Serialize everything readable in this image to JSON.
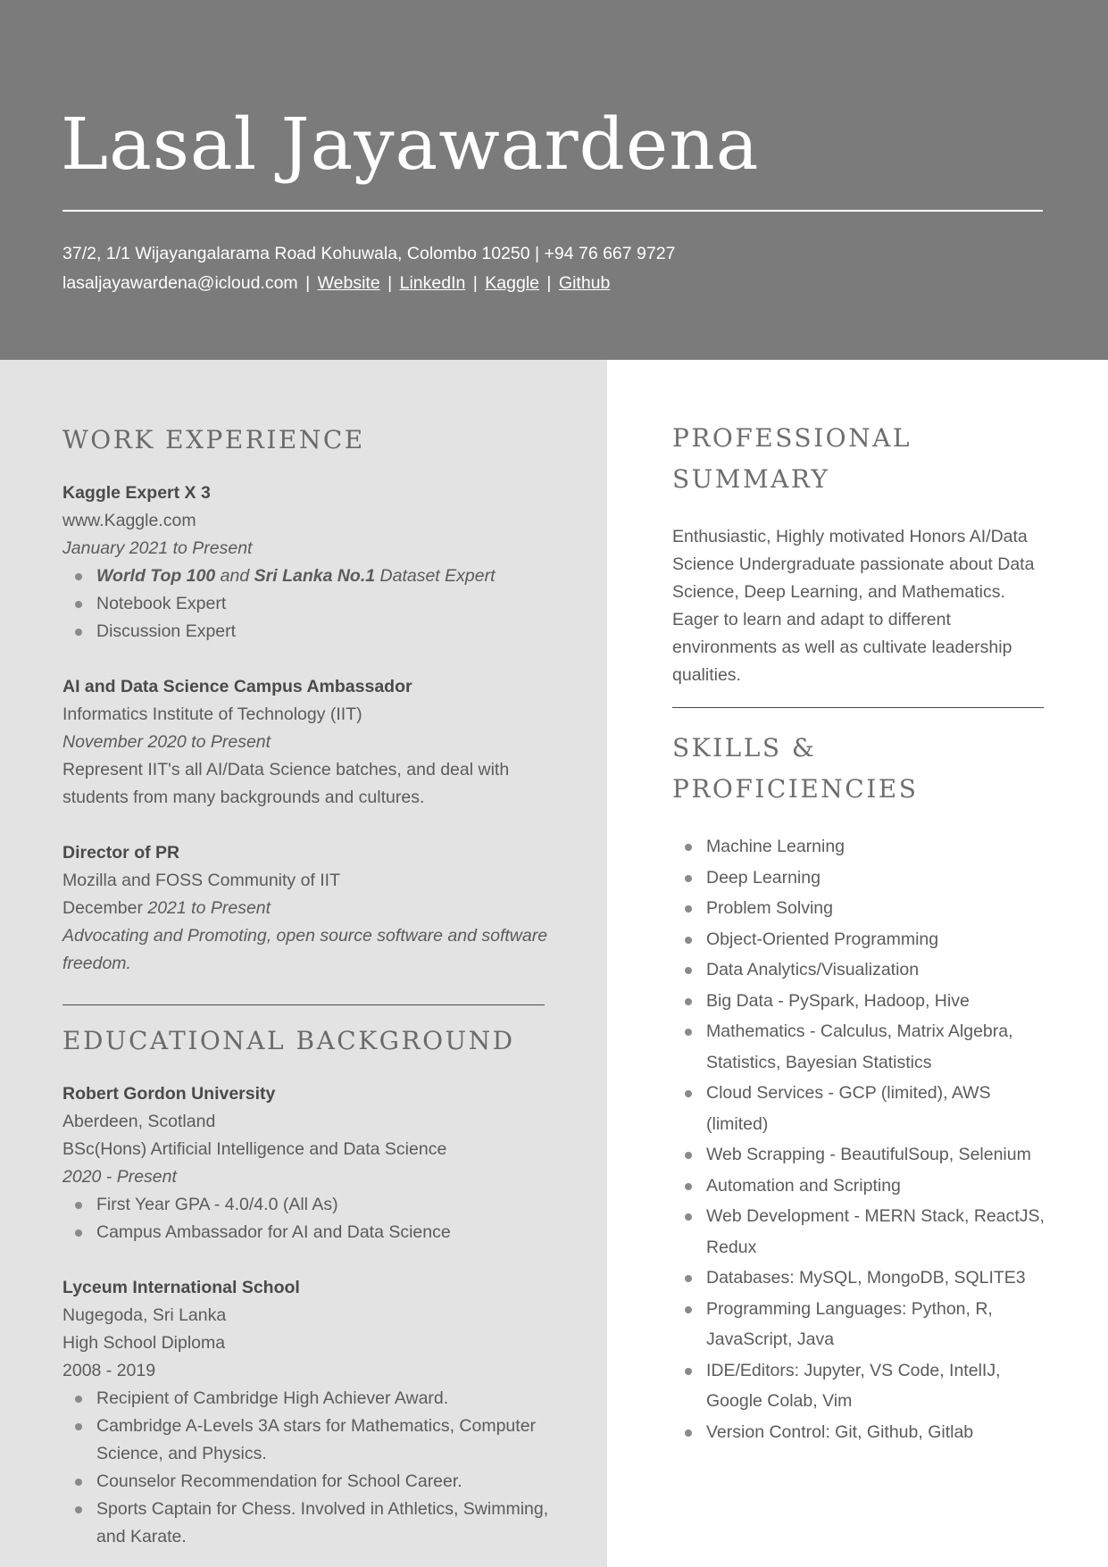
{
  "header": {
    "name": "Lasal Jayawardena",
    "address_phone": "37/2, 1/1 Wijayangalarama Road Kohuwala, Colombo 10250 | +94 76 667 9727",
    "email": "lasaljayawardena@icloud.com",
    "links": [
      "Website",
      "LinkedIn",
      "Kaggle",
      "Github"
    ],
    "separator": "|"
  },
  "work_experience": {
    "title": "WORK EXPERIENCE",
    "entries": [
      {
        "title": "Kaggle Expert X 3",
        "org": "www.Kaggle.com",
        "dates": "January 2021 to Present",
        "bullets": [
          {
            "parts": [
              {
                "text": "World Top 100",
                "style": "bold-italic"
              },
              {
                "text": " and ",
                "style": "italic"
              },
              {
                "text": "Sri Lanka No.1",
                "style": "bold-italic"
              },
              {
                "text": " Dataset Expert",
                "style": "italic"
              }
            ]
          },
          {
            "text": "Notebook Expert"
          },
          {
            "text": "Discussion Expert"
          }
        ]
      },
      {
        "title": "AI and Data Science Campus Ambassador",
        "org": "Informatics Institute of Technology (IIT)",
        "dates": "November 2020 to Present",
        "description": "Represent IIT's all AI/Data Science batches, and deal with students from many backgrounds and cultures."
      },
      {
        "title": "Director of PR",
        "org": "Mozilla and FOSS Community of IIT",
        "dates_month": "December",
        "dates_rest": " 2021 to Present",
        "description": "Advocating and Promoting, open source software and software freedom."
      }
    ]
  },
  "education": {
    "title": "EDUCATIONAL BACKGROUND",
    "entries": [
      {
        "institution": "Robert Gordon University",
        "location": "Aberdeen, Scotland",
        "degree": "BSc(Hons) Artificial Intelligence and Data Science",
        "dates": "2020 - Present",
        "bullets": [
          "First Year GPA - 4.0/4.0 (All As)",
          "Campus Ambassador for AI and Data Science"
        ]
      },
      {
        "institution": "Lyceum International School",
        "location": "Nugegoda, Sri Lanka",
        "degree": "High School Diploma",
        "dates": "2008 - 2019",
        "bullets": [
          "Recipient of Cambridge High Achiever Award.",
          "Cambridge A-Levels 3A stars for Mathematics, Computer Science, and Physics.",
          "Counselor Recommendation for School Career.",
          "Sports Captain for Chess. Involved in Athletics, Swimming, and Karate."
        ]
      }
    ]
  },
  "summary": {
    "title_line1": "PROFESSIONAL",
    "title_line2": "SUMMARY",
    "text": "Enthusiastic, Highly motivated Honors AI/Data Science Undergraduate passionate about Data Science, Deep Learning, and Mathematics. Eager to learn and adapt to different environments as well as cultivate leadership qualities."
  },
  "skills": {
    "title_line1": "SKILLS &",
    "title_line2": "PROFICIENCIES",
    "items": [
      "Machine Learning",
      "Deep Learning",
      "Problem Solving",
      "Object-Oriented Programming",
      "Data Analytics/Visualization",
      "Big Data - PySpark, Hadoop, Hive",
      "Mathematics - Calculus, Matrix Algebra, Statistics, Bayesian Statistics",
      "Cloud Services - GCP (limited), AWS (limited)",
      "Web Scrapping - BeautifulSoup, Selenium",
      "Automation and Scripting",
      "Web Development - MERN Stack, ReactJS, Redux",
      "Databases: MySQL, MongoDB, SQLITE3",
      "Programming Languages: Python, R, JavaScript, Java",
      "IDE/Editors: Jupyter, VS Code, IntelIJ, Google Colab, Vim",
      "Version Control: Git, Github, Gitlab"
    ]
  },
  "colors": {
    "header_bg": "#7b7b7b",
    "left_column_bg": "#e3e3e3",
    "header_text": "#ffffff"
  }
}
